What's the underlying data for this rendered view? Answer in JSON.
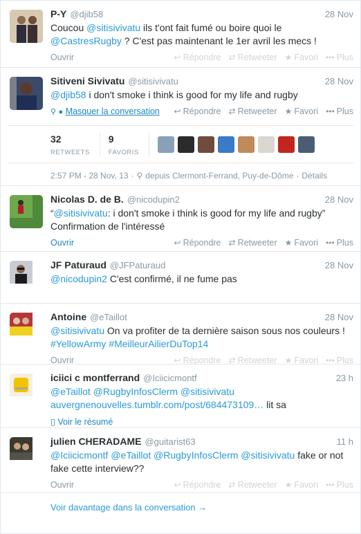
{
  "colors": {
    "link": "#2a9ad7",
    "muted": "#8899a6",
    "text": "#292f33"
  },
  "actions": {
    "reply": "Répondre",
    "retweet": "Retweeter",
    "favorite": "Favori",
    "more": "Plus"
  },
  "main_tweet": {
    "fullname": "Sitiveni Sivivatu",
    "username": "@sitisivivatu",
    "time": "28 Nov",
    "mention": "@djib58",
    "text": " i don't smoke  i think is good for my life and rugby",
    "hide_label": "Masquer la conversation",
    "retweets_count": "32",
    "retweets_label": "RETWEETS",
    "favorites_count": "9",
    "favorites_label": "FAVORIS",
    "datetime": "2:57 PM - 28 Nov, 13",
    "location": "depuis Clermont-Ferrand, Puy-de-Dôme",
    "details": "Détails"
  },
  "prev_tweet": {
    "fullname": "P-Y",
    "username": "@djib58",
    "time": "28 Nov",
    "t1": "Coucou ",
    "m1": "@sitisivivatu",
    "t2": " ils t'ont fait fumé ou boire quoi le ",
    "m2": "@CastresRugby",
    "t3": " ? C'est pas maintenant le 1er avril les mecs !",
    "expand": "Ouvrir"
  },
  "replies": [
    {
      "fullname": "Nicolas D. de B.",
      "username": "@nicodupin2",
      "time": "28 Nov",
      "q": "“",
      "mention": "@sitisivivatu",
      "text": ": i don't smoke  i think is good for my life and rugby” Confirmation de l'intéressé",
      "expand": "Ouvrir"
    },
    {
      "fullname": "JF Paturaud",
      "username": "@JFPaturaud",
      "time": "28 Nov",
      "mention": "@nicodupin2",
      "text": " C'est confirmé, il ne fume pas"
    },
    {
      "fullname": "Antoine",
      "username": "@eTaillot",
      "time": "28 Nov",
      "mention": "@sitisivivatu",
      "text": " On va profiter de ta dernière saison sous nos couleurs ! ",
      "h1": "#YellowArmy",
      "h2": "#MeilleurAilierDuTop14",
      "expand": "Ouvrir"
    },
    {
      "fullname": "iciici c montferrand",
      "username": "@Iciicicmontf",
      "time": "23 h",
      "m1": "@eTaillot",
      "m2": "@RugbyInfosClerm",
      "m3": "@sitisivivatu",
      "url": "auvergnenouvelles.tumblr.com/post/684473109…",
      "tail": " lit sa",
      "expand": "Voir le résumé"
    },
    {
      "fullname": "julien CHERADAME",
      "username": "@guitarist63",
      "time": "11 h",
      "m1": "@Iciicicmontf",
      "m2": "@eTaillot",
      "m3": "@RugbyInfosClerm",
      "m4": "@sitisivivatu",
      "tail": " fake or not fake cette interview??",
      "expand": "Ouvrir"
    }
  ],
  "more_link": "Voir davantage dans la conversation →",
  "icons": {
    "reply": "reply-arrow-icon",
    "retweet": "retweet-icon",
    "favorite": "star-icon",
    "more": "dots-icon",
    "location": "pin-icon",
    "conversation": "speech-bubble-icon",
    "summary": "document-icon"
  }
}
